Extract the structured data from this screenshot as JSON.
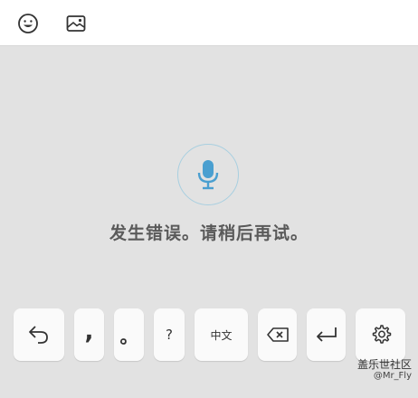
{
  "toolbar": {
    "emoji_icon": "smiley-icon",
    "sticker_icon": "image-sticker-icon"
  },
  "voice": {
    "mic_icon": "microphone-icon",
    "accent_color": "#4a9fd0",
    "error_message": "发生错误。请稍后再试。"
  },
  "keys": {
    "undo_icon": "undo-icon",
    "comma": ",",
    "period": "。",
    "question": "?",
    "language": "中文",
    "delete_icon": "backspace-icon",
    "enter_icon": "enter-icon",
    "settings_icon": "gear-icon"
  },
  "watermark": {
    "title": "盖乐世社区",
    "user": "@Mr_Fly"
  }
}
